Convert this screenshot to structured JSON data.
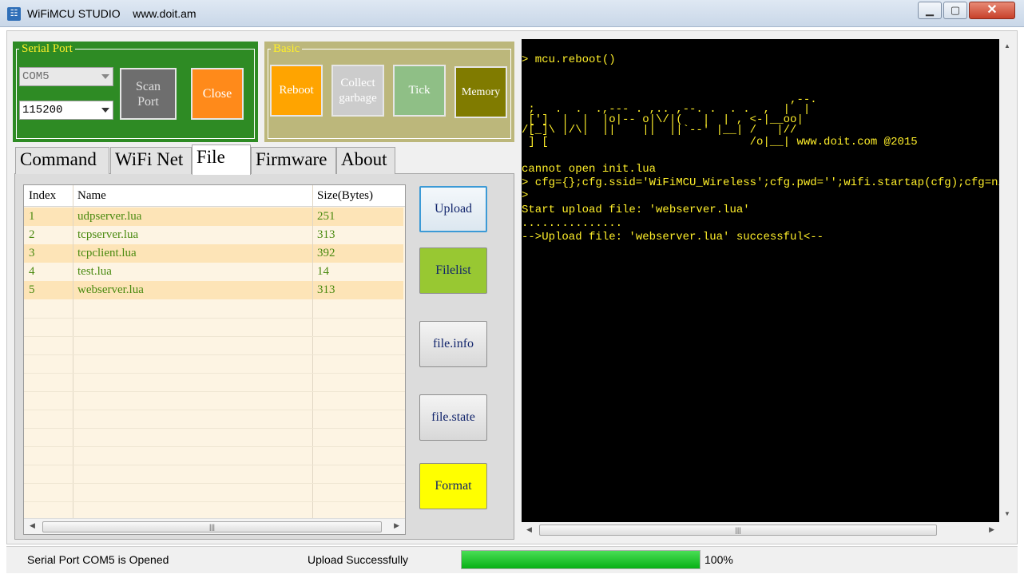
{
  "window": {
    "title": "WiFiMCU STUDIO    www.doit.am",
    "minimize_glyph": "▁",
    "maximize_glyph": "▢",
    "close_glyph": "✕",
    "app_icon": "rss-icon"
  },
  "serial_port": {
    "legend": "Serial Port",
    "port_value": "COM5",
    "baud_value": "115200",
    "scan_label_line1": "Scan",
    "scan_label_line2": "Port",
    "close_label": "Close"
  },
  "basic": {
    "legend": "Basic",
    "reboot_label": "Reboot",
    "collect_line1": "Collect",
    "collect_line2": "garbage",
    "tick_label": "Tick",
    "memory_label": "Memory"
  },
  "tabs": [
    {
      "label": "Command"
    },
    {
      "label": "WiFi Net"
    },
    {
      "label": "File"
    },
    {
      "label": "Firmware"
    },
    {
      "label": "About"
    }
  ],
  "active_tab": "File",
  "file_table": {
    "headers": [
      "Index",
      "Name",
      "Size(Bytes)"
    ],
    "rows": [
      {
        "index": "1",
        "name": "udpserver.lua",
        "size": "251"
      },
      {
        "index": "2",
        "name": "tcpserver.lua",
        "size": "313"
      },
      {
        "index": "3",
        "name": "tcpclient.lua",
        "size": "392"
      },
      {
        "index": "4",
        "name": "test.lua",
        "size": "14"
      },
      {
        "index": "5",
        "name": "webserver.lua",
        "size": "313"
      }
    ]
  },
  "file_actions": {
    "upload": "Upload",
    "filelist": "Filelist",
    "info": "file.info",
    "state": "file.state",
    "format": "Format"
  },
  "terminal": {
    "lines": [
      "> mcu.reboot()",
      "",
      "",
      "                                        ,--.",
      " ;   .  .  .,--- . ,.. ,--. .  . .  ,  |  |",
      " [']  |  |  |o|-- o|\\/|(   |  | , <-|__oo|",
      "/[_]\\ |/\\|  ||    ||  ||`--' |__| /   |//",
      " ] [                              /o|__| www.doit.com @2015",
      "",
      "cannot open init.lua",
      "> cfg={};cfg.ssid='WiFiMCU_Wireless';cfg.pwd='';wifi.startap(cfg);cfg=nil",
      ">",
      "Start upload file: 'webserver.lua'",
      "...............",
      "-->Upload file: 'webserver.lua' successful<--"
    ]
  },
  "status": {
    "port_status": "Serial Port COM5 is Opened",
    "message": "Upload Successfully",
    "progress_fraction": 1.0,
    "progress_text": "100%"
  },
  "colors": {
    "serial_group": "#2e8b24",
    "basic_group": "#bcb77b",
    "terminal_text": "#ffef2a",
    "table_text": "#4a8a10",
    "progress": "#07b015"
  }
}
